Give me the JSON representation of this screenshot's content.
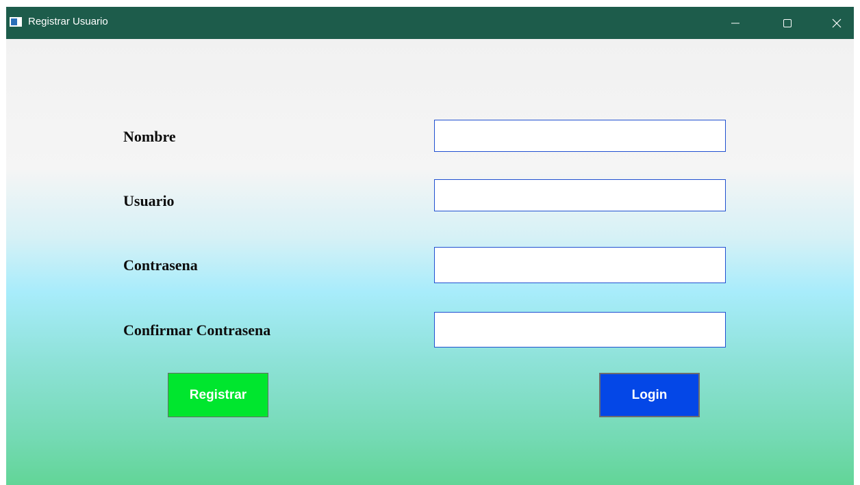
{
  "window": {
    "title": "Registrar Usuario",
    "icon": "app-window-icon",
    "controls": {
      "minimize": "minimize-icon",
      "maximize": "maximize-icon",
      "close": "close-icon"
    }
  },
  "form": {
    "fields": {
      "nombre": {
        "label": "Nombre",
        "value": "",
        "placeholder": ""
      },
      "usuario": {
        "label": "Usuario",
        "value": "",
        "placeholder": ""
      },
      "contrasena": {
        "label": "Contrasena",
        "value": "",
        "placeholder": ""
      },
      "confirmar": {
        "label": "Confirmar Contrasena",
        "value": "",
        "placeholder": ""
      }
    },
    "buttons": {
      "registrar": "Registrar",
      "login": "Login"
    }
  },
  "colors": {
    "titlebar": "#1d5c4b",
    "registrar_button": "#00e62e",
    "login_button": "#0447e7",
    "field_border": "#1f4fd0"
  }
}
